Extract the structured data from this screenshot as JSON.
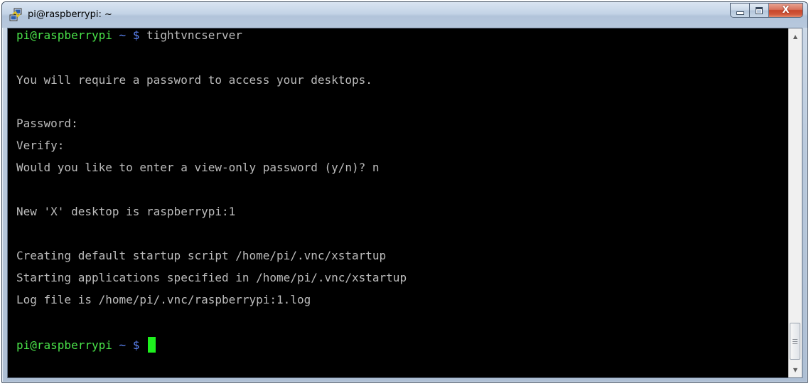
{
  "window": {
    "title": "pi@raspberrypi: ~",
    "close_label": "X"
  },
  "terminal": {
    "prompt_user": "pi@raspberrypi",
    "prompt_tilde": "~",
    "prompt_symbol": "$",
    "command": "tightvncserver",
    "output_lines": [
      "You will require a password to access your desktops.",
      "Password:",
      "Verify:",
      "Would you like to enter a view-only password (y/n)? n",
      "New 'X' desktop is raspberrypi:1",
      "Creating default startup script /home/pi/.vnc/xstartup",
      "Starting applications specified in /home/pi/.vnc/xstartup",
      "Log file is /home/pi/.vnc/raspberrypi:1.log"
    ]
  },
  "colors": {
    "background": "#000000",
    "text": "#bcbcbc",
    "prompt_user": "#4ae34a",
    "prompt_tilde": "#5b82f0",
    "cursor": "#1ef01e"
  },
  "icons": {
    "app": "putty-icon",
    "minimize": "minimize-icon",
    "maximize": "maximize-icon",
    "close": "close-icon",
    "scroll_up": "scroll-up-arrow-icon",
    "scroll_down": "scroll-down-arrow-icon"
  }
}
